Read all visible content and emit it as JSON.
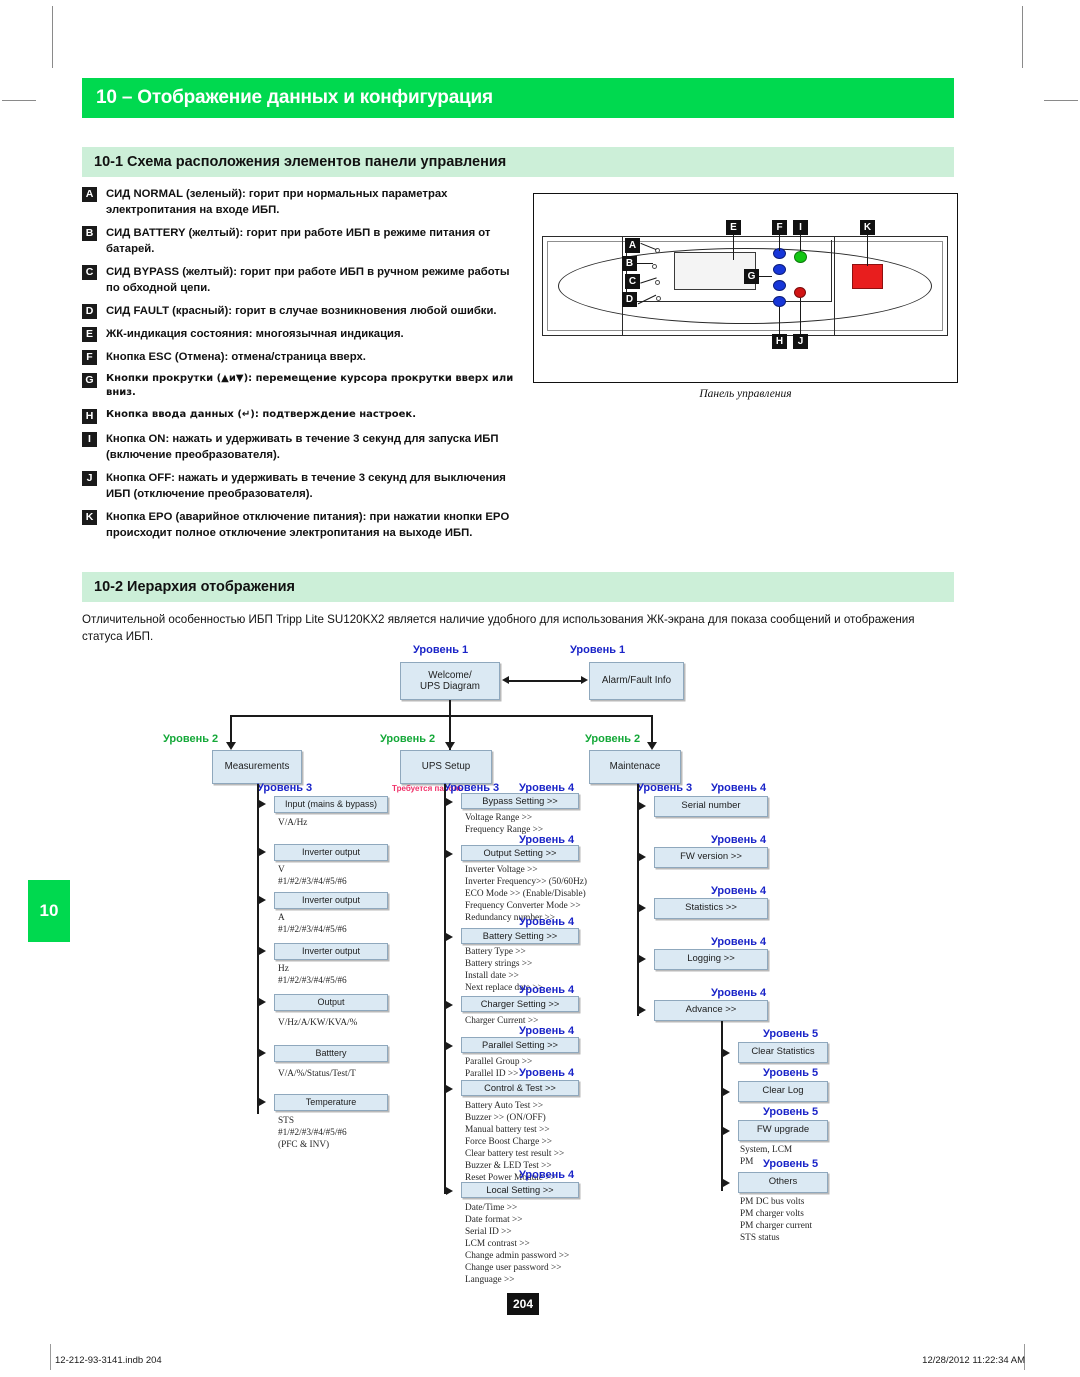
{
  "document": {
    "chapter_tab": "10",
    "title": "10 – Отображение данных и конфигурация",
    "page_number": "204",
    "footer_left": "12-212-93-3141.indb   204",
    "footer_right": "12/28/2012   11:22:34 AM"
  },
  "colors": {
    "brand_green": "#00d94f",
    "section_green": "#ccefd8",
    "node_blue": "#dbe9f3",
    "level_blue": "#1a24c8",
    "level_green": "#14a838",
    "password_red": "#f0326a"
  },
  "section_10_1": {
    "heading": "10-1 Схема расположения элементов панели управления",
    "items": [
      {
        "tag": "A",
        "text": "СИД NORMAL (зеленый): горит при нормальных параметрах электропитания на входе ИБП."
      },
      {
        "tag": "B",
        "text": "СИД BATTERY (желтый): горит при работе ИБП в режиме питания от батарей."
      },
      {
        "tag": "C",
        "text": "СИД BYPASS (желтый): горит при работе ИБП в ручном режиме работы по обходной цепи."
      },
      {
        "tag": "D",
        "text": "СИД FAULT (красный): горит в случае возникновения любой ошибки."
      },
      {
        "tag": "E",
        "text": "ЖК-индикация состояния: многоязычная индикация."
      },
      {
        "tag": "F",
        "text": "Кнопка ESC (Отмена): отмена/страница вверх."
      },
      {
        "tag": "G",
        "text": "Кнопки прокрутки (▲и▼): перемещение курсора прокрутки вверх или вниз."
      },
      {
        "tag": "H",
        "text": "Кнопка ввода данных (↵): подтверждение настроек."
      },
      {
        "tag": "I",
        "text": "Кнопка ON: нажать и удерживать в течение 3 секунд для запуска ИБП (включение преобразователя)."
      },
      {
        "tag": "J",
        "text": "Кнопка OFF: нажать и удерживать в течение 3 секунд для выключения ИБП (отключение преобразователя)."
      },
      {
        "tag": "K",
        "text": "Кнопка EPO (аварийное отключение питания): при нажатии кнопки EPO происходит полное отключение электропитания на выходе ИБП."
      }
    ],
    "figure_caption": "Панель управления",
    "figure_callouts": [
      "A",
      "B",
      "C",
      "D",
      "E",
      "F",
      "G",
      "H",
      "I",
      "J",
      "K"
    ]
  },
  "section_10_2": {
    "heading": "10-2 Иерархия отображения",
    "paragraph": "Отличительной особенностью ИБП Tripp Lite SU120KX2 является наличие удобного для использования ЖК-экрана для показа сообщений и отображения статуса ИБП.",
    "labels": {
      "level1": "Уровень 1",
      "level2": "Уровень 2",
      "level3": "Уровень 3",
      "level4": "Уровень  4",
      "level5": "Уровень  5",
      "password_required": "Требуется\nпароль"
    },
    "level1": [
      {
        "id": "welcome",
        "label": "Welcome/\nUPS Diagram"
      },
      {
        "id": "alarm",
        "label": "Alarm/Fault Info"
      }
    ],
    "level2": [
      {
        "id": "measurements",
        "label": "Measurements"
      },
      {
        "id": "ups-setup",
        "label": "UPS Setup"
      },
      {
        "id": "maintenance",
        "label": "Maintenace"
      }
    ],
    "measurements_branch": [
      {
        "label": "Input (mains & bypass)",
        "sub": "V/A/Hz"
      },
      {
        "label": "Inverter output",
        "sub": "V\n#1/#2/#3/#4/#5/#6"
      },
      {
        "label": "Inverter output",
        "sub": "A\n#1/#2/#3/#4/#5/#6"
      },
      {
        "label": "Inverter output",
        "sub": "Hz\n#1/#2/#3/#4/#5/#6"
      },
      {
        "label": "Output",
        "sub": "V/Hz/A/KW/KVA/%"
      },
      {
        "label": "Batttery",
        "sub": "V/A/%/Status/Test/T"
      },
      {
        "label": "Temperature",
        "sub": "STS\n#1/#2/#3/#4/#5/#6\n(PFC & INV)"
      }
    ],
    "ups_setup_branch": [
      {
        "label": "Bypass Setting >>",
        "sub": "Voltage Range  >>\nFrequency Range  >>"
      },
      {
        "label": "Output Setting >>",
        "sub": "Inverter Voltage >>\nInverter Frequency>> (50/60Hz)\nECO Mode  >> (Enable/Disable)\nFrequency Converter Mode >>\nRedundancy number  >>"
      },
      {
        "label": "Battery Setting >>",
        "sub": "Battery Type >>\nBattery strings  >>\nInstall date  >>\nNext replace date >>"
      },
      {
        "label": "Charger Setting >>",
        "sub": "Charger Current >>"
      },
      {
        "label": "Parallel  Setting >>",
        "sub": "Parallel Group >>\nParallel ID >>"
      },
      {
        "label": "Control & Test >>",
        "sub": "Battery Auto Test >>\nBuzzer  >> (ON/OFF)\nManual battery test  >>\nForce Boost Charge  >>\nClear battery test result >>\nBuzzer & LED Test >>\nReset Power Module >>"
      },
      {
        "label": "Local Setting >>",
        "sub": "Date/Time  >>\nDate format >>\nSerial ID >>\nLCM contrast  >>\nChange admin password  >>\nChange user password  >>\nLanguage  >>"
      }
    ],
    "maintenance_branch": [
      {
        "label": "Serial number",
        "sub": ""
      },
      {
        "label": "FW version >>",
        "sub": ""
      },
      {
        "label": "Statistics  >>",
        "sub": ""
      },
      {
        "label": "Logging >>",
        "sub": ""
      },
      {
        "label": "Advance >>",
        "sub": ""
      }
    ],
    "advance_branch": [
      {
        "label": "Clear Statistics",
        "sub": ""
      },
      {
        "label": "Clear Log",
        "sub": ""
      },
      {
        "label": "FW upgrade",
        "sub": "System, LCM\nPM"
      },
      {
        "label": "Others",
        "sub": "PM DC bus volts\nPM charger volts\nPM charger current\nSTS status"
      }
    ]
  }
}
